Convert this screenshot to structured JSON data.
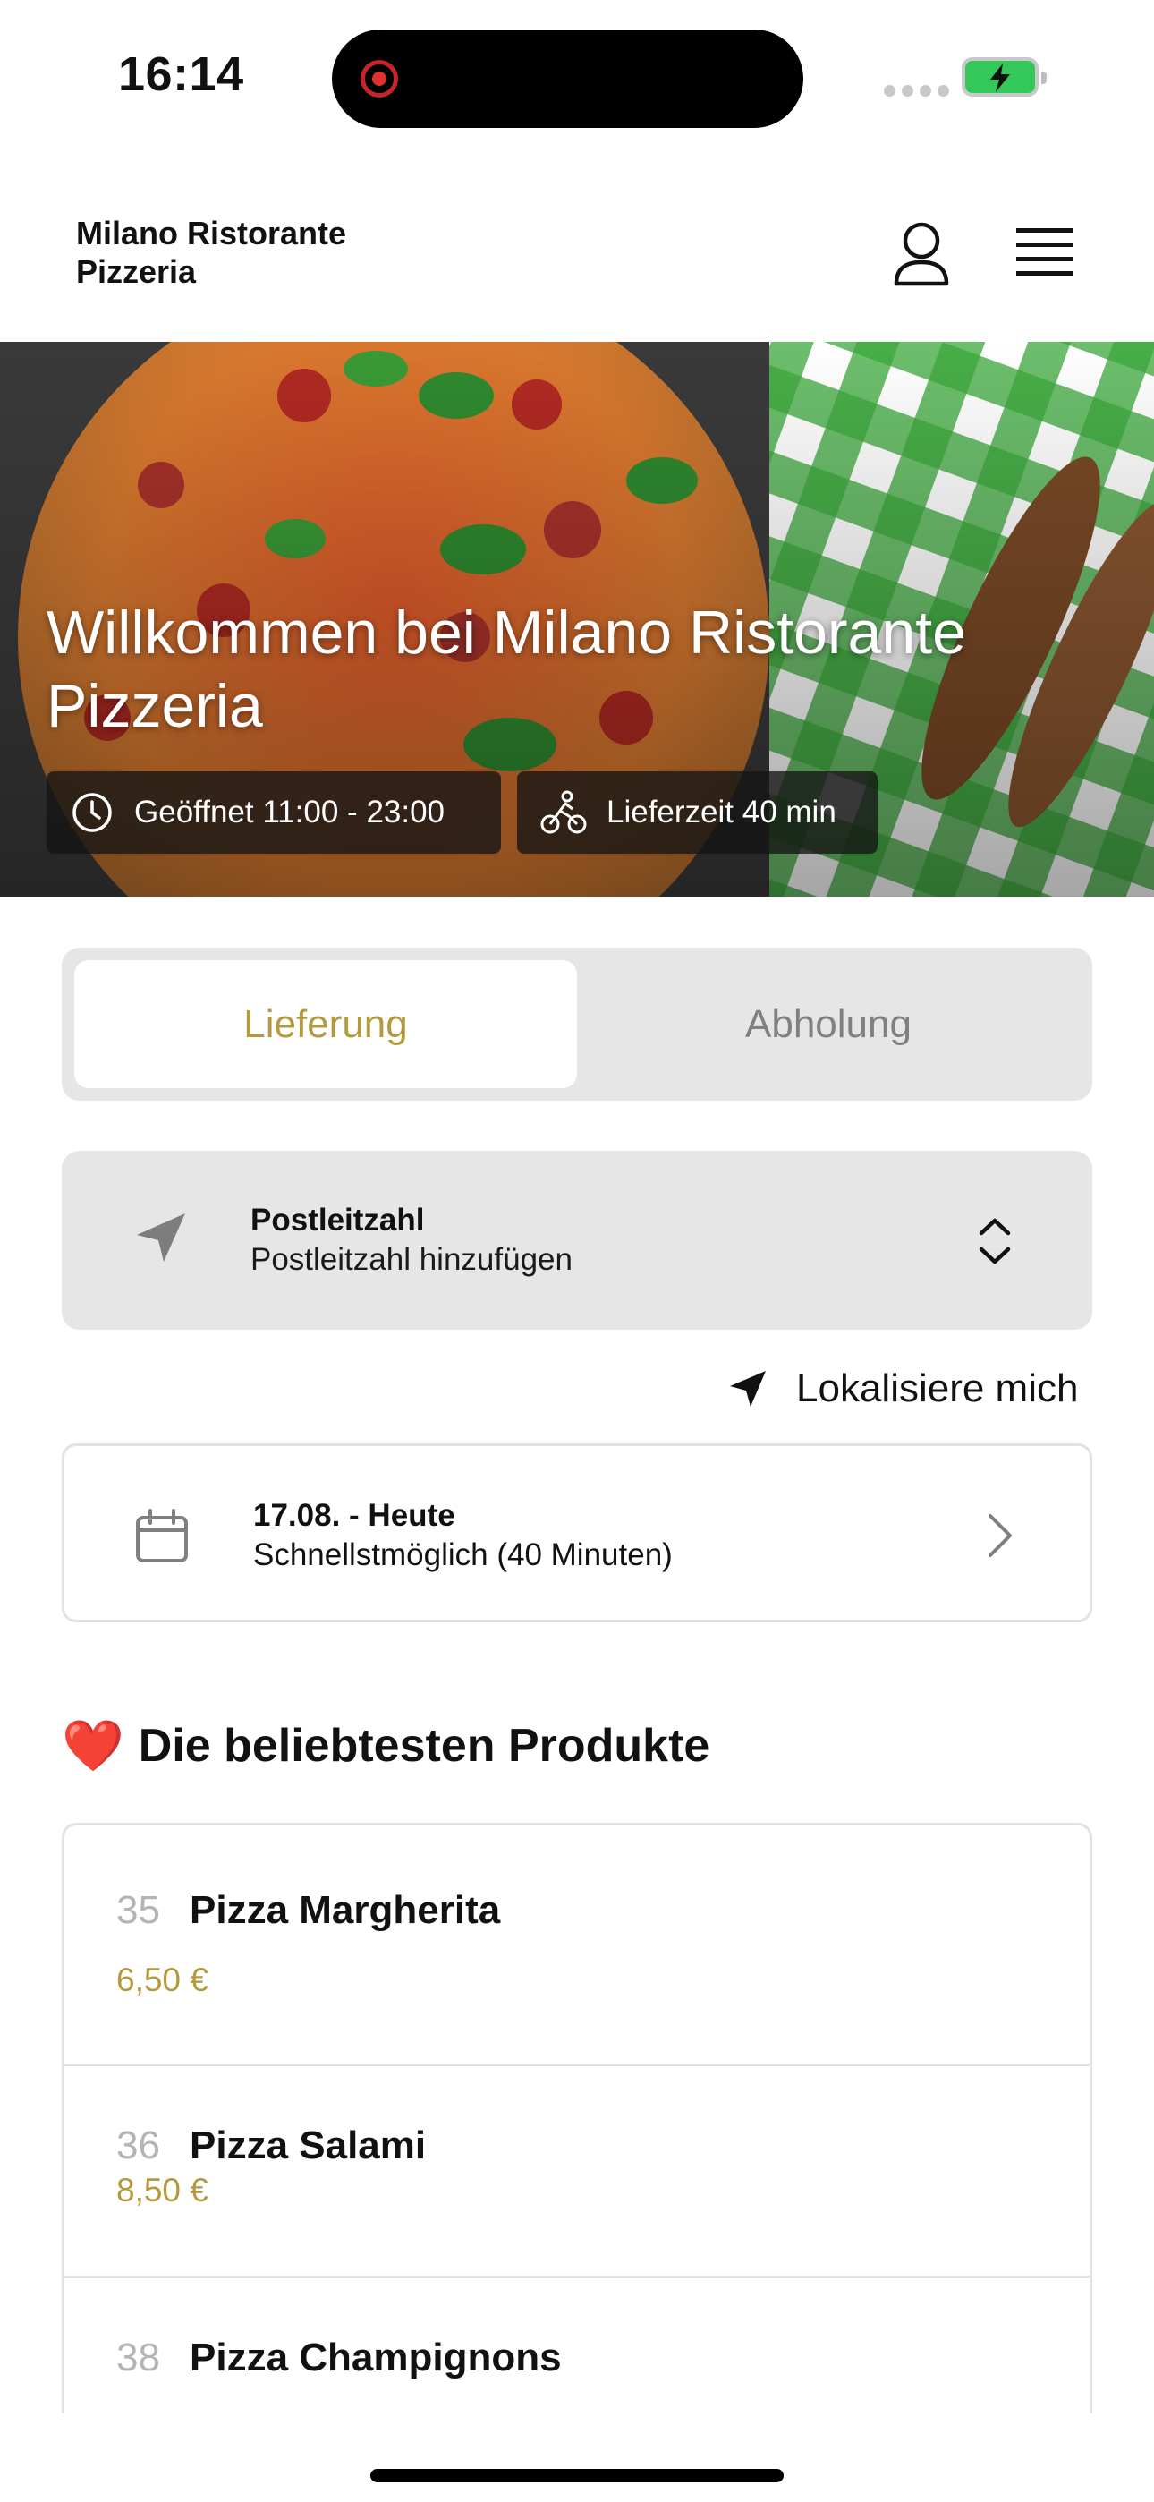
{
  "status_bar": {
    "time": "16:14",
    "signal_icon": "cellular-signal-icon",
    "battery_icon": "battery-charging-icon",
    "battery_color": "#34c759"
  },
  "header": {
    "brand": "Milano Ristorante Pizzeria",
    "account_icon": "user-icon",
    "menu_icon": "hamburger-menu-icon"
  },
  "hero": {
    "title": "Willkommen bei Milano Ristorante Pizzeria",
    "opening_hours": "Geöffnet 11:00 - 23:00",
    "delivery_time": "Lieferzeit 40 min",
    "opening_icon": "clock-icon",
    "delivery_icon": "cyclist-icon"
  },
  "mode_toggle": {
    "options": [
      {
        "label": "Lieferung",
        "selected": true
      },
      {
        "label": "Abholung",
        "selected": false
      }
    ],
    "accent_color": "#b49a3f"
  },
  "postal_code": {
    "label": "Postleitzahl",
    "placeholder": "Postleitzahl hinzufügen",
    "icon": "location-arrow-icon"
  },
  "locate_me": {
    "label": "Lokalisiere mich",
    "icon": "navigation-arrow-icon"
  },
  "schedule": {
    "date": "17.08. - Heute",
    "time": "Schnellstmöglich (40 Minuten)",
    "icon": "calendar-icon"
  },
  "popular": {
    "title": "Die beliebtesten Produkte",
    "heart": "❤️",
    "products": [
      {
        "number": "35",
        "name": "Pizza Margherita",
        "price": "6,50 €"
      },
      {
        "number": "36",
        "name": "Pizza Salami",
        "price": "8,50 €"
      },
      {
        "number": "38",
        "name": "Pizza Champignons",
        "price": ""
      }
    ]
  }
}
